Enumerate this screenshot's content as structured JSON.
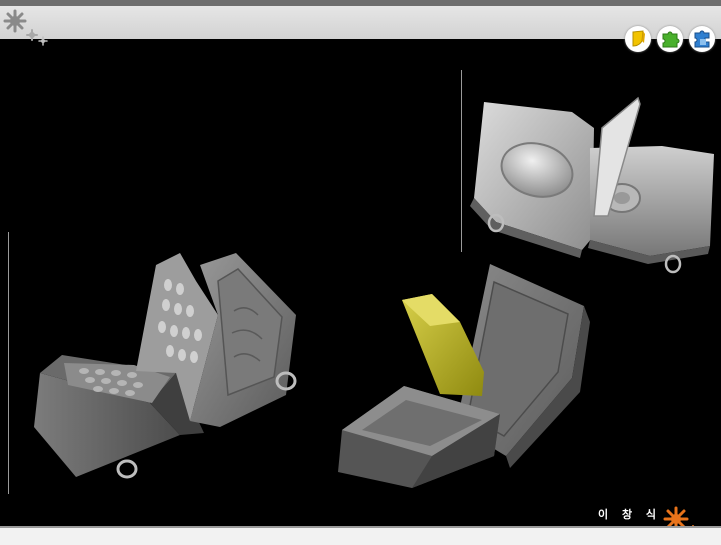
{
  "slide": {
    "author_name": "이 창 식",
    "accent_color": "#e8731a",
    "header_color": "#dcdcdc"
  },
  "nav_buttons": [
    {
      "icon": "yellow-page-icon",
      "color": "#f2c300"
    },
    {
      "icon": "green-puzzle-icon",
      "color": "#49b02c"
    },
    {
      "icon": "blue-puzzle-icon",
      "color": "#2f7fd0"
    }
  ],
  "renders": [
    {
      "subject": "flip-phone-mockup-with-screen"
    },
    {
      "subject": "flip-phone-mockup-with-keypad"
    },
    {
      "subject": "flip-phone-mockup-with-yellow-panel"
    }
  ]
}
